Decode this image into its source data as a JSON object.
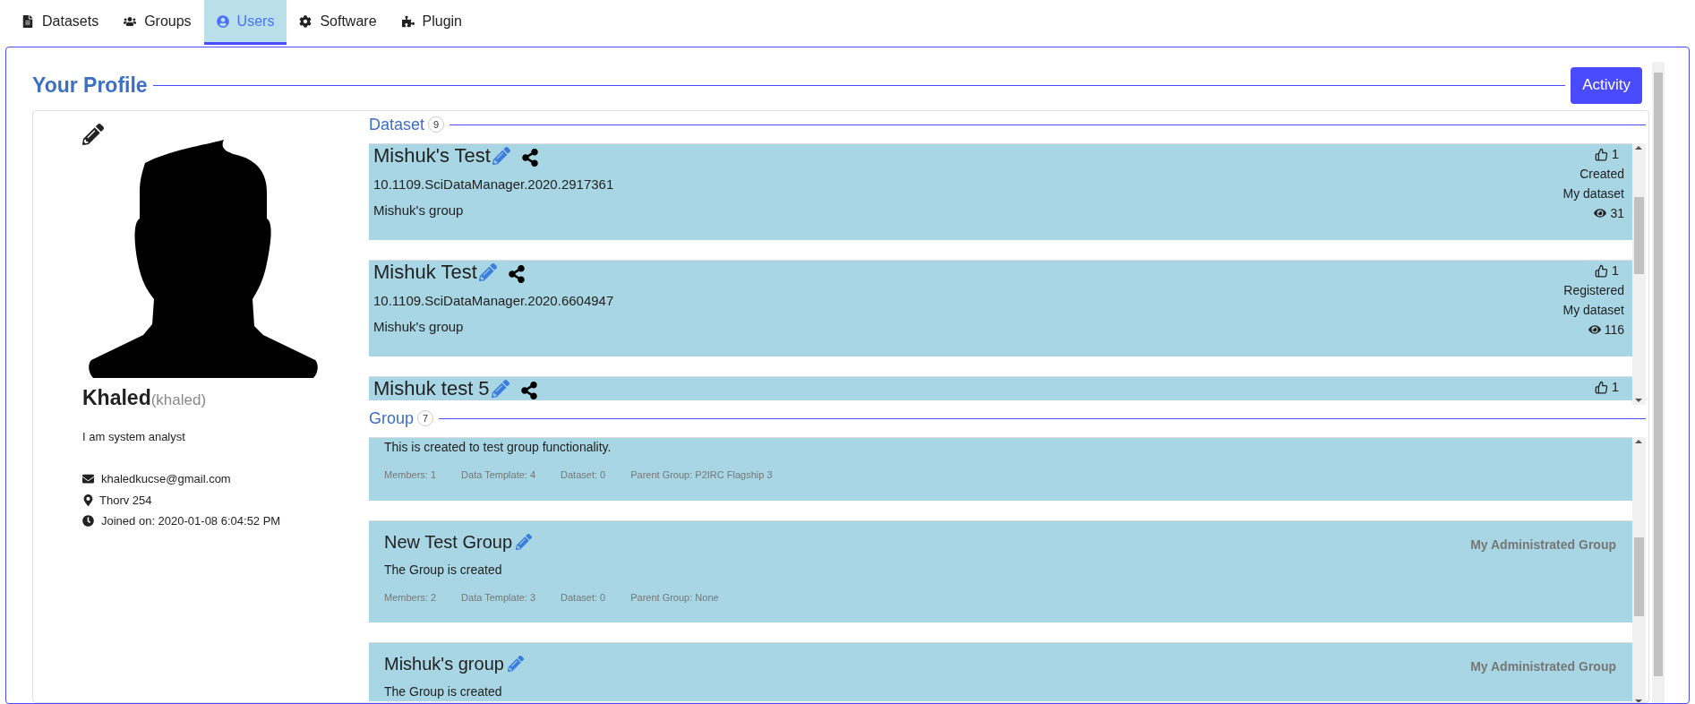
{
  "tabs": [
    {
      "label": "Datasets",
      "selected": false
    },
    {
      "label": "Groups",
      "selected": false
    },
    {
      "label": "Users",
      "selected": true
    },
    {
      "label": "Software",
      "selected": false
    },
    {
      "label": "Plugin",
      "selected": false
    }
  ],
  "profile": {
    "title": "Your Profile",
    "activity_button": "Activity",
    "name": "Khaled",
    "username": "(khaled)",
    "bio": "I am system analyst",
    "email": "khaledkucse@gmail.com",
    "location": "Thorv 254",
    "joined": "Joined on: 2020-01-08 6:04:52 PM"
  },
  "datasets": {
    "title": "Dataset",
    "count": "9",
    "items": [
      {
        "title": "Mishuk's Test",
        "doi": "10.1109.SciDataManager.2020.2917361",
        "group": "Mishuk's group",
        "likes": "1",
        "status": "Created",
        "ownership": "My dataset",
        "views": "31"
      },
      {
        "title": "Mishuk Test",
        "doi": "10.1109.SciDataManager.2020.6604947",
        "group": "Mishuk's group",
        "likes": "1",
        "status": "Registered",
        "ownership": "My dataset",
        "views": "116"
      },
      {
        "title": "Mishuk test 5",
        "likes": "1"
      }
    ]
  },
  "groups": {
    "title": "Group",
    "count": "7",
    "items": [
      {
        "description": "This is created to test group functionality.",
        "stats": [
          "Members: 1",
          "Data Template: 4",
          "Dataset: 0",
          "Parent Group: P2IRC Flagship 3"
        ]
      },
      {
        "title": "New Test Group",
        "role": "My Administrated Group",
        "description": "The Group is created",
        "stats": [
          "Members: 2",
          "Data Template: 3",
          "Dataset: 0",
          "Parent Group: None"
        ]
      },
      {
        "title": "Mishuk's group",
        "role": "My Administrated Group",
        "description": "The Group is created"
      }
    ]
  }
}
